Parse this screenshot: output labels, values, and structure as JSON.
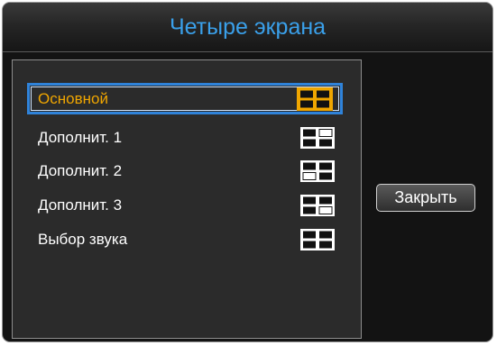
{
  "dialog": {
    "title": "Четыре экрана",
    "close_label": "Закрыть"
  },
  "menu": {
    "items": [
      {
        "label": "Основной",
        "icon": "quad-layout-main-icon",
        "selected": true
      },
      {
        "label": "Дополнит. 1",
        "icon": "quad-layout-sub1-icon",
        "selected": false
      },
      {
        "label": "Дополнит. 2",
        "icon": "quad-layout-sub2-icon",
        "selected": false
      },
      {
        "label": "Дополнит. 3",
        "icon": "quad-layout-sub3-icon",
        "selected": false
      },
      {
        "label": "Выбор звука",
        "icon": "quad-layout-sound-icon",
        "selected": false
      }
    ]
  },
  "colors": {
    "title_text": "#3aa0ea",
    "selected_text": "#f0a600",
    "selection_border": "#2f83da",
    "selected_icon": "#f0a600"
  }
}
